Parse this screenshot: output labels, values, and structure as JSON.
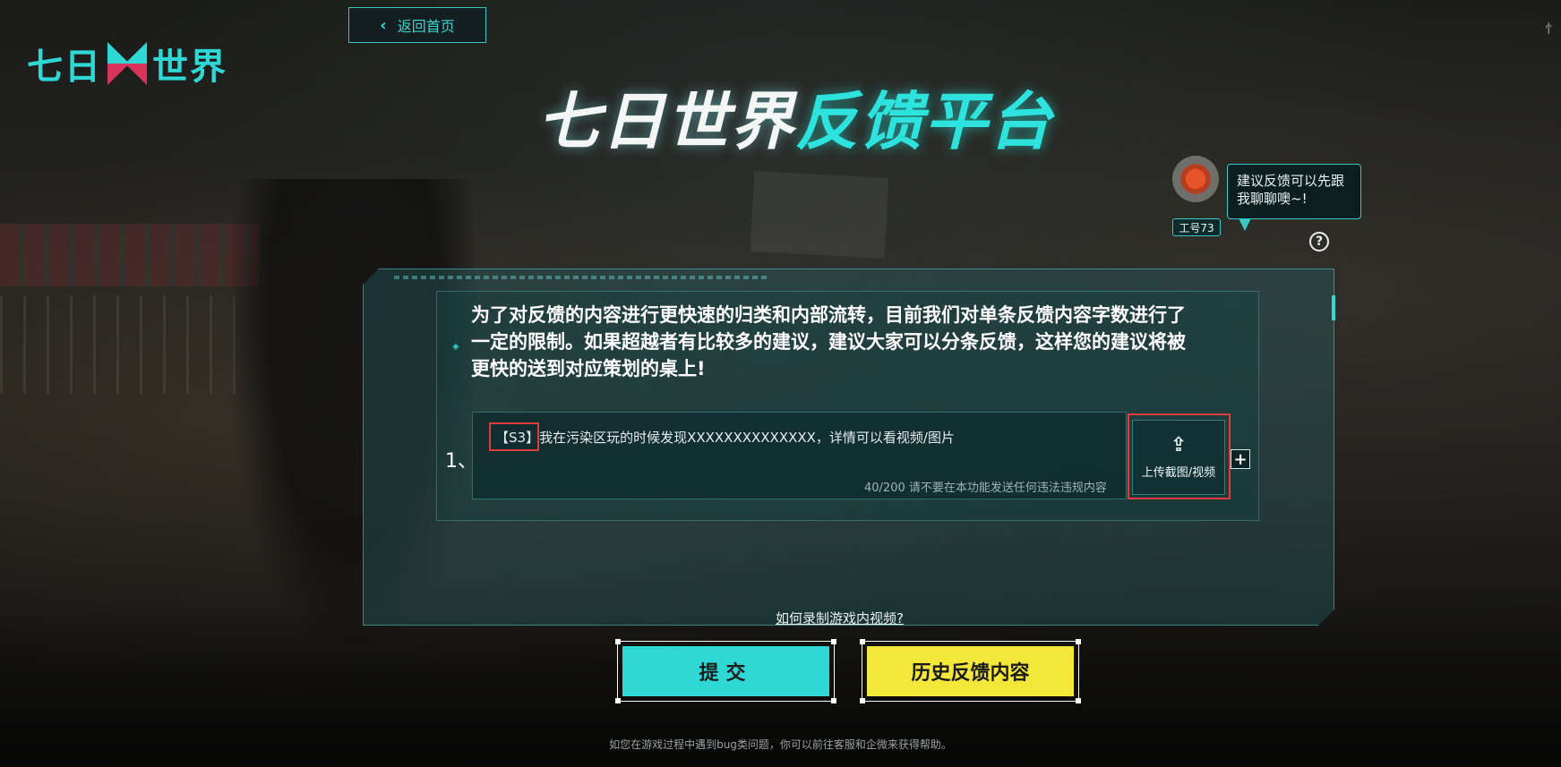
{
  "logo": {
    "text_left": "七日",
    "text_right": "世界"
  },
  "back_button": {
    "label": "返回首页"
  },
  "page_title": {
    "part1": "七日世界",
    "part2": "反馈平台"
  },
  "assistant": {
    "bubble": "建议反馈可以先跟\n我聊聊噢~!",
    "tag": "工号73",
    "help": "?"
  },
  "notice": "为了对反馈的内容进行更快速的归类和内部流转，目前我们对单条反馈内容字数进行了\n一定的限制。如果超越者有比较多的建议，建议大家可以分条反馈，这样您的建议将被\n更快的送到对应策划的桌上!",
  "entries": [
    {
      "index": "1、",
      "text": "【S3】我在污染区玩的时候发现XXXXXXXXXXXXXX，详情可以看视频/图片",
      "counter": "40/200 请不要在本功能发送任何违法违规内容",
      "upload_label": "上传截图/视频"
    }
  ],
  "add_entry": "+",
  "video_help_link": "如何录制游戏内视频?",
  "buttons": {
    "submit": "提交",
    "history": "历史反馈内容"
  },
  "footer_note": "如您在游戏过程中遇到bug类问题，你可以前往客服和企微来获得帮助。",
  "edge_glyph": "忄",
  "colors": {
    "accent_cyan": "#2fd8d4",
    "accent_yellow": "#f3e83a",
    "highlight_red": "#e23b3b"
  },
  "icons": {
    "back": "chevron-left-icon",
    "upload": "upload-icon",
    "add": "plus-icon",
    "help": "question-icon",
    "notice": "diamond-icon"
  }
}
